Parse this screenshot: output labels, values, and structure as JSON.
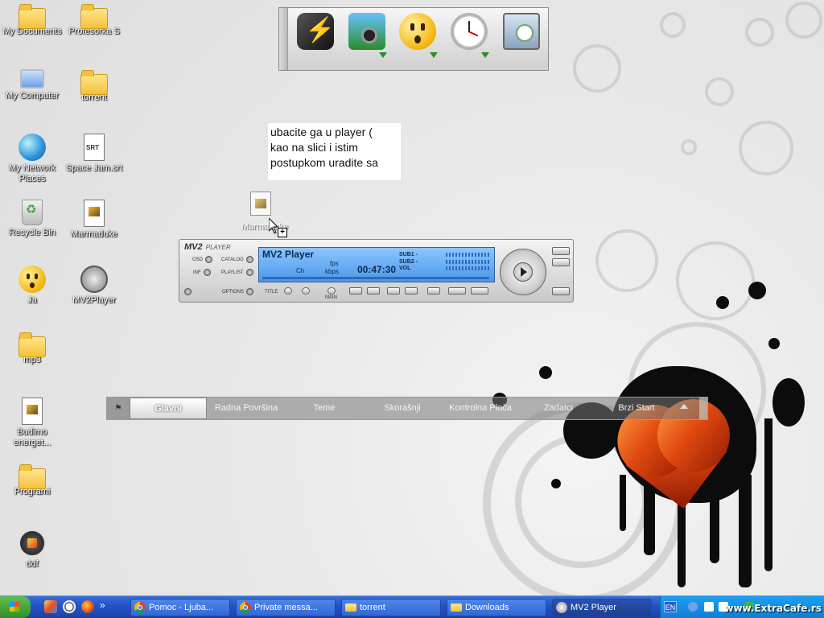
{
  "desktop": {
    "icons": [
      {
        "label": "My Documents",
        "icon": "my-documents-icon"
      },
      {
        "label": "My Computer",
        "icon": "my-computer-icon"
      },
      {
        "label": "My Network Places",
        "icon": "network-places-icon"
      },
      {
        "label": "Recycle Bin",
        "icon": "recycle-bin-icon"
      },
      {
        "label": "Ja",
        "icon": "smiley-icon"
      },
      {
        "label": "mp3",
        "icon": "folder-icon"
      },
      {
        "label": "Budimo energet...",
        "icon": "winamp-file-icon"
      },
      {
        "label": "Programi",
        "icon": "folder-icon"
      },
      {
        "label": "ddf",
        "icon": "ddf-icon"
      },
      {
        "label": "Profesorka S",
        "icon": "folder-icon"
      },
      {
        "label": "torrent",
        "icon": "folder-icon"
      },
      {
        "label": "Space Jam.srt",
        "icon": "subtitle-file-icon"
      },
      {
        "label": "Marmaduke",
        "icon": "winamp-file-icon"
      },
      {
        "label": "MV2Player",
        "icon": "mv2player-shortcut-icon"
      }
    ],
    "dragged_item_label": "Marmaduke",
    "note_text": "ubacite ga u player (\nkao na slici i istim\npostupkom uradite sa"
  },
  "dock": {
    "items": [
      {
        "icon": "winamp-icon"
      },
      {
        "icon": "camera-icon"
      },
      {
        "icon": "smiley-icon"
      },
      {
        "icon": "clock-icon"
      },
      {
        "icon": "monitor-clock-icon"
      }
    ]
  },
  "player": {
    "brand": "MV2",
    "brand_suffix": "PLAYER",
    "title": "MV2 Player",
    "osd": "OSD",
    "inf": "INF",
    "catalog": "CATALOG",
    "playlist": "PLAYLIST",
    "options": "OPTIONS",
    "title_label": "TITLE",
    "main_label": "MAIN",
    "ch": "Ch",
    "fps": "fps",
    "kbps": "kbps",
    "time": "00:47:30",
    "sub1": "SUB1 -",
    "sub2": "SUB2 -",
    "vol": "VOL"
  },
  "tabbar": {
    "tabs": [
      "Glavni",
      "Radna Površina",
      "Teme",
      "Skorašnji",
      "Kontrolna Ploča",
      "Zadatci",
      "Brzi Start"
    ],
    "active": 0
  },
  "taskbar": {
    "tasks": [
      {
        "label": "Pomoc - Ljuba...",
        "icon": "chrome-icon"
      },
      {
        "label": "Private messa...",
        "icon": "chrome-icon"
      },
      {
        "label": "torrent",
        "icon": "folder-icon"
      },
      {
        "label": "Downloads",
        "icon": "folder-icon"
      },
      {
        "label": "MV2 Player",
        "icon": "mv2player-icon"
      }
    ],
    "language": "EN",
    "watermark": "www.ExtraCafe.rs"
  }
}
